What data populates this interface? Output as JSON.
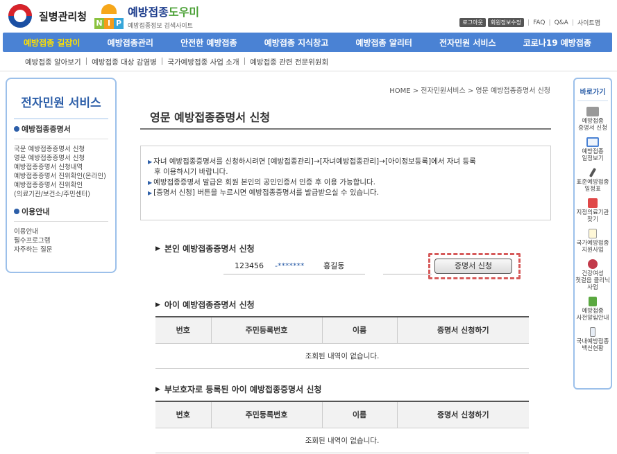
{
  "header": {
    "kdca_name": "질병관리청",
    "nip_letters": [
      "N",
      "I",
      "P"
    ],
    "nip_title_main": "예방접종",
    "nip_title_accent": "도우미",
    "nip_subtitle": "예방접종정보 검색사이트",
    "util": {
      "logout": "로그아웃",
      "member_edit": "회원정보수정",
      "faq": "FAQ",
      "qa": "Q&A",
      "sitemap": "사이트맵"
    }
  },
  "gnb": {
    "items": [
      "예방접종 길잡이",
      "예방접종관리",
      "안전한 예방접종",
      "예방접종 지식창고",
      "예방접종 알리터",
      "전자민원 서비스",
      "코로나19 예방접종"
    ]
  },
  "subnav": {
    "items": [
      "예방접종 알아보기",
      "예방접종 대상 감염병",
      "국가예방접종 사업 소개",
      "예방접종 관련 전문위원회"
    ]
  },
  "lnb": {
    "title": "전자민원 서비스",
    "section1": "예방접종증명서",
    "section1_items": [
      "국문 예방접종증명서 신청",
      "영문 예방접종증명서 신청",
      "예방접종증명서 신청내역",
      "예방접종증명서 진위확인(온라인)",
      "예방접종증명서 진위확인",
      "(의료기관/보건소/주민센터)"
    ],
    "section2": "이용안내",
    "section2_items": [
      "이용안내",
      "필수프로그램",
      "자주하는 질문"
    ]
  },
  "main": {
    "breadcrumb": "HOME > 전자민원서비스 > 영문 예방접종증명서 신청",
    "title": "영문 예방접종증명서 신청",
    "info": [
      "자녀 예방접종증명서를 신청하시려면 [예방접종관리]→[자녀예방접종관리]→[아이정보등록]에서 자녀 등록",
      "후 이용하시기 바랍니다.",
      "예방접종증명서 발급은 회원 본인의 공인인증서 인증 후 이용 가능합니다.",
      "[증명서 신청] 버튼을 누르시면 예방접종증명서를 발급받으실 수 있습니다."
    ],
    "self_section": "본인 예방접종증명서 신청",
    "self_id_front": "123456",
    "self_id_back": "-*******",
    "self_name": "홍길동",
    "cert_button": "증명서 신청",
    "child_section": "아이 예방접종증명서 신청",
    "guardian_section": "부보호자로 등록된 아이 예방접종증명서 신청",
    "table_headers": [
      "번호",
      "주민등록번호",
      "이름",
      "증명서 신청하기"
    ],
    "empty_message": "조회된 내역이 없습니다."
  },
  "quick": {
    "title": "바로가기",
    "items": [
      {
        "label1": "예방접종",
        "label2": "증명서 신청",
        "icon": "printer-icon"
      },
      {
        "label1": "예방접종",
        "label2": "일정보기",
        "icon": "calendar-icon"
      },
      {
        "label1": "표준예방접종",
        "label2": "일정표",
        "icon": "pen-icon"
      },
      {
        "label1": "지정의료기관",
        "label2": "찾기",
        "icon": "hospital-icon"
      },
      {
        "label1": "국가예방접종",
        "label2": "지원사업",
        "icon": "document-icon"
      },
      {
        "label1": "건강여성",
        "label2": "첫걸음 클리닉사업",
        "icon": "heart-icon"
      },
      {
        "label1": "예방접종",
        "label2": "사전알림안내",
        "icon": "speaker-icon"
      },
      {
        "label1": "국내예방접종",
        "label2": "백신현황",
        "icon": "vaccine-icon"
      }
    ]
  }
}
